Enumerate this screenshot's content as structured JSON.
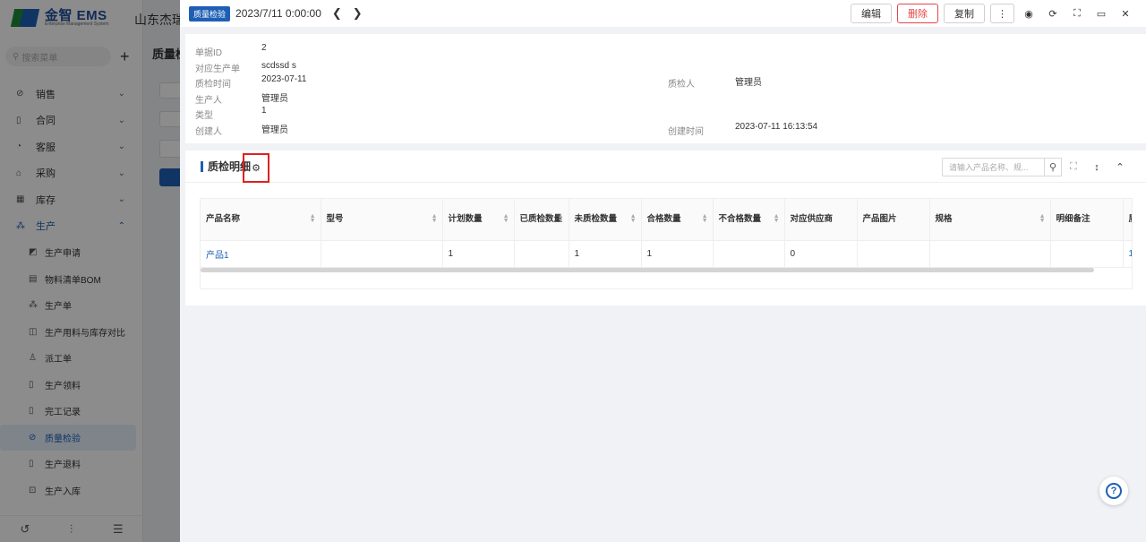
{
  "app": {
    "logo_text": "金智 EMS",
    "logo_subtext": "Enterprise Management System",
    "company_name": "山东杰瑞",
    "search_placeholder": "搜索菜单",
    "plus_label": "+",
    "page_title": "质量检"
  },
  "sidebar": {
    "items": [
      {
        "label": "销售",
        "icon": "sales-icon"
      },
      {
        "label": "合同",
        "icon": "contract-icon"
      },
      {
        "label": "客服",
        "icon": "service-icon"
      },
      {
        "label": "采购",
        "icon": "purchase-icon"
      },
      {
        "label": "库存",
        "icon": "inventory-icon"
      },
      {
        "label": "生产",
        "icon": "production-icon"
      }
    ],
    "sub_items": [
      {
        "label": "生产申请",
        "icon": "request-icon"
      },
      {
        "label": "物料清单BOM",
        "icon": "bom-icon"
      },
      {
        "label": "生产单",
        "icon": "order-icon"
      },
      {
        "label": "生产用料与库存对比",
        "icon": "compare-icon"
      },
      {
        "label": "派工单",
        "icon": "dispatch-icon"
      },
      {
        "label": "生产领料",
        "icon": "picking-icon"
      },
      {
        "label": "完工记录",
        "icon": "completion-icon"
      },
      {
        "label": "质量检验",
        "icon": "quality-icon"
      },
      {
        "label": "生产退料",
        "icon": "return-icon"
      },
      {
        "label": "生产入库",
        "icon": "stock-in-icon"
      }
    ]
  },
  "drawer": {
    "tag": "质量检验",
    "date": "2023/7/11 0:00:00",
    "buttons": {
      "edit": "编辑",
      "delete": "删除",
      "copy": "复制"
    },
    "info": {
      "doc_id_label": "单据ID",
      "doc_id": "2",
      "prod_order_label": "对应生产单",
      "prod_order": "scdssd s",
      "check_time_label": "质检时间",
      "check_time": "2023-07-11",
      "producer_label": "生产人",
      "producer": "管理员",
      "type_label": "类型",
      "type": "1",
      "creator_label": "创建人",
      "creator": "管理员",
      "inspector_label": "质检人",
      "inspector": "管理员",
      "created_time_label": "创建时间",
      "created_time": "2023-07-11 16:13:54"
    },
    "detail": {
      "title": "质检明细",
      "search_placeholder": "请输入产品名称、规...",
      "columns": [
        "产品名称",
        "型号",
        "计划数量",
        "已质检数量",
        "未质检数量",
        "合格数量",
        "不合格数量",
        "对应供应商",
        "产品图片",
        "规格",
        "明细备注",
        "质"
      ],
      "row": [
        "产品1",
        "",
        "1",
        "",
        "1",
        "1",
        "",
        "0",
        "",
        "",
        "",
        "1"
      ]
    },
    "help": "?"
  }
}
